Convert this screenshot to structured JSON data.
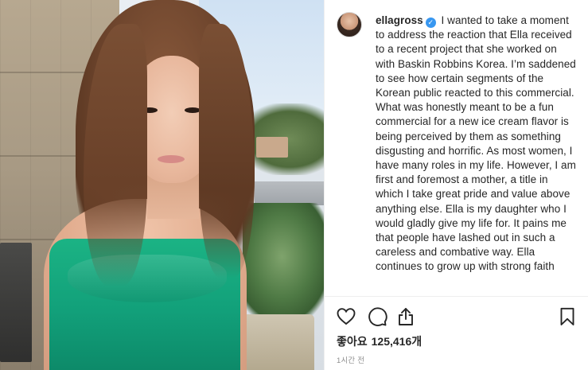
{
  "post": {
    "username": "ellagross",
    "verified_badge": "verified-badge-icon",
    "caption": "I wanted to take a moment to address the reaction that Ella received to a recent project that she worked on with Baskin Robbins Korea. I’m saddened to see how certain segments of the Korean public reacted to this commercial. What was honestly meant to be a fun commercial for a new ice cream flavor is being perceived by them as something disgusting and horrific. As most women, I have many roles in my life. However, I am first and foremost a mother, a title in which I take great pride and value above anything else. Ella is my daughter who I would gladly give my life for. It pains me that people have lashed out in such a careless and combative way. Ella continues to grow up with strong faith",
    "likes_label": "좋아요",
    "likes_count": "125,416개",
    "timestamp": "1시간 전"
  },
  "icons": {
    "like": "heart-icon",
    "comment": "comment-bubble-icon",
    "share": "share-icon",
    "save": "bookmark-icon"
  },
  "colors": {
    "text": "#262626",
    "muted": "#8e8e8e",
    "verified": "#3897f0",
    "dress": "#12a07a"
  }
}
